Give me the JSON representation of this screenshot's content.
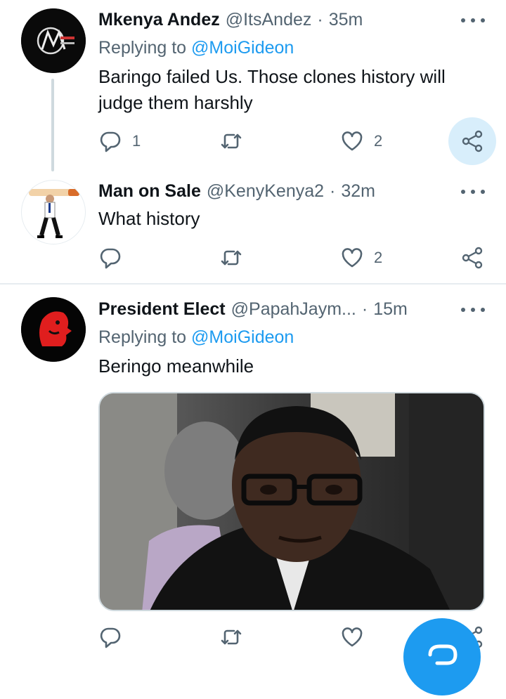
{
  "tweets": [
    {
      "name": "Mkenya Andez",
      "handle": "@ItsAndez",
      "dot": "·",
      "time": "35m",
      "reply_prefix": "Replying to",
      "reply_to": "@MoiGideon",
      "text": "Baringo failed Us. Those clones history will judge them harshly",
      "replies": "1",
      "likes": "2"
    },
    {
      "name": "Man on Sale",
      "handle": "@KenyKenya2",
      "dot": "·",
      "time": "32m",
      "text": "What history",
      "likes": "2"
    },
    {
      "name": "President Elect",
      "handle": "@PapahJaym...",
      "dot": "·",
      "time": "15m",
      "reply_prefix": "Replying to",
      "reply_to": "@MoiGideon",
      "text": "Beringo meanwhile"
    }
  ],
  "colors": {
    "accent": "#1d9bf0",
    "muted": "#536471",
    "share_highlight": "#d8eefb"
  },
  "icons": [
    "reply-icon",
    "retweet-icon",
    "like-icon",
    "share-icon",
    "more-icon",
    "compose-icon"
  ]
}
